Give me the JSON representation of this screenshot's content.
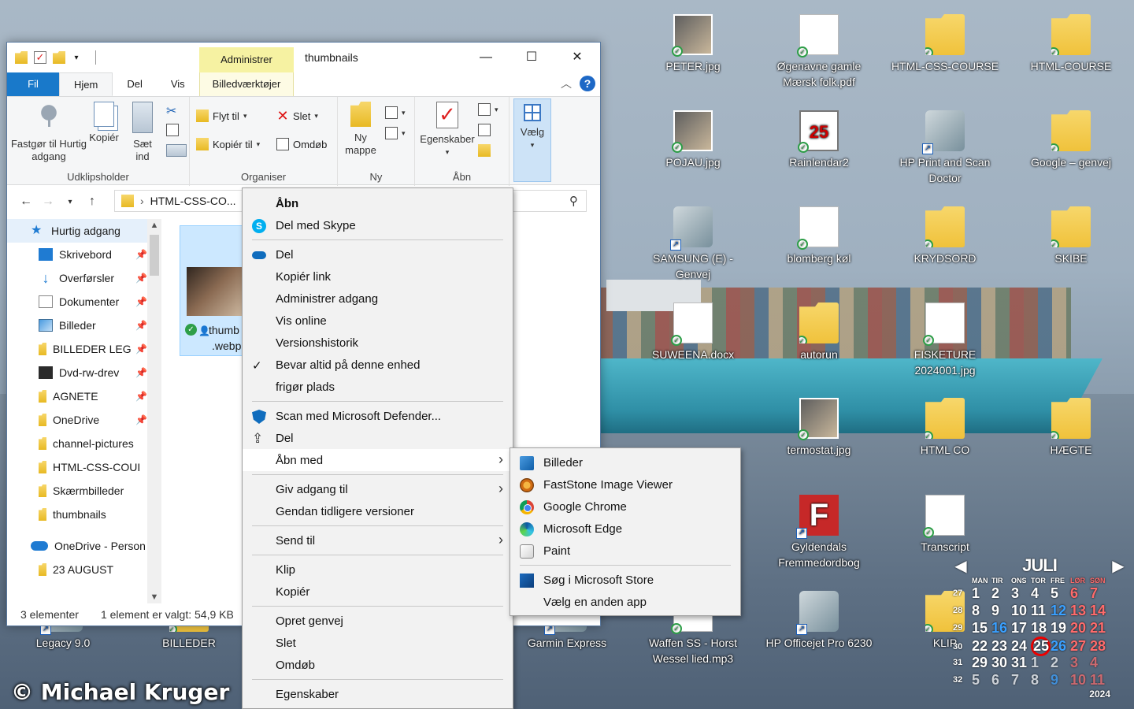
{
  "desktop": {
    "icons": [
      {
        "label": "PETER.jpg",
        "type": "img"
      },
      {
        "label": "Øgenavne gamle Mærsk folk.pdf",
        "type": "doc"
      },
      {
        "label": "HTML-CSS-COURSE",
        "type": "folder"
      },
      {
        "label": "HTML-COURSE",
        "type": "folder"
      },
      {
        "label": "POJAU.jpg",
        "type": "img"
      },
      {
        "label": "Rainlendar2",
        "type": "cal"
      },
      {
        "label": "HP Print and Scan Doctor",
        "type": "tool"
      },
      {
        "label": "Google – genvej",
        "type": "folder"
      },
      {
        "label": "SAMSUNG (E) - Genvej",
        "type": "tool"
      },
      {
        "label": "blomberg køl",
        "type": "doc"
      },
      {
        "label": "KRYDSORD",
        "type": "folder"
      },
      {
        "label": "SKIBE",
        "type": "folder"
      },
      {
        "label": "SUWEENA.docx",
        "type": "doc"
      },
      {
        "label": "autorun",
        "type": "folder"
      },
      {
        "label": "FISKETURE 2024001.jpg",
        "type": "doc"
      },
      {
        "label": "termostat.jpg",
        "type": "img"
      },
      {
        "label": "HTML CO",
        "type": "folder"
      },
      {
        "label": "HÆGTE",
        "type": "folder"
      },
      {
        "label": "Gyldendals Fremmedordbog",
        "type": "app"
      },
      {
        "label": "Transcript",
        "type": "doc"
      },
      {
        "label": "HP Officejet Pro 6230",
        "type": "tool"
      },
      {
        "label": "Waffen SS - Horst Wessel lied.mp3",
        "type": "doc"
      },
      {
        "label": "Garmin Express",
        "type": "tool"
      },
      {
        "label": "Legacy 9.0",
        "type": "tool"
      },
      {
        "label": "BILLEDER",
        "type": "folder"
      },
      {
        "label": "KLIP",
        "type": "folder"
      }
    ],
    "copyright": "© Michael Kruger"
  },
  "calendar": {
    "month": "JULI",
    "weekday_headers": [
      "MAN",
      "TIR",
      "ONS",
      "TOR",
      "FRE",
      "LØR",
      "SØN"
    ],
    "weeks": [
      {
        "wk": "27",
        "days": [
          "1",
          "2",
          "3",
          "4",
          "5",
          "6",
          "7"
        ]
      },
      {
        "wk": "28",
        "days": [
          "8",
          "9",
          "10",
          "11",
          "12",
          "13",
          "14"
        ]
      },
      {
        "wk": "29",
        "days": [
          "15",
          "16",
          "17",
          "18",
          "19",
          "20",
          "21"
        ]
      },
      {
        "wk": "30",
        "days": [
          "22",
          "23",
          "24",
          "25",
          "26",
          "27",
          "28"
        ]
      },
      {
        "wk": "31",
        "days": [
          "29",
          "30",
          "31",
          "1",
          "2",
          "3",
          "4"
        ]
      },
      {
        "wk": "32",
        "days": [
          "5",
          "6",
          "7",
          "8",
          "9",
          "10",
          "11"
        ]
      }
    ],
    "today": "25",
    "year": "2024"
  },
  "explorer": {
    "title": "thumbnails",
    "context_tab_header": "Administrer",
    "tabs": [
      "Fil",
      "Hjem",
      "Del",
      "Vis"
    ],
    "context_tab": "Billedværktøjer",
    "ribbon": {
      "clipboard": {
        "pin": "Fastgør til Hurtig adgang",
        "copy": "Kopiér",
        "paste": "Sæt ind",
        "label": "Udklipsholder"
      },
      "organize": {
        "move_to": "Flyt til",
        "copy_to": "Kopiér til",
        "delete": "Slet",
        "rename": "Omdøb",
        "label": "Organiser"
      },
      "new": {
        "new_folder": "Ny mappe",
        "label": "Ny"
      },
      "open": {
        "properties": "Egenskaber",
        "label": "Åbn"
      },
      "select": {
        "select": "Vælg"
      }
    },
    "address": "HTML-CSS-CO...",
    "nav": [
      {
        "label": "Hurtig adgang",
        "icon": "star-icon",
        "head": true
      },
      {
        "label": "Skrivebord",
        "icon": "desktop-icon",
        "pinned": true
      },
      {
        "label": "Overførsler",
        "icon": "download-icon",
        "pinned": true
      },
      {
        "label": "Dokumenter",
        "icon": "document-icon",
        "pinned": true
      },
      {
        "label": "Billeder",
        "icon": "pictures-icon",
        "pinned": true
      },
      {
        "label": "BILLEDER LEG",
        "icon": "folder-icon",
        "pinned": true
      },
      {
        "label": "Dvd-rw-drev",
        "icon": "dvd-icon",
        "pinned": true
      },
      {
        "label": "AGNETE",
        "icon": "folder-icon",
        "pinned": true
      },
      {
        "label": "OneDrive",
        "icon": "folder-icon",
        "pinned": true
      },
      {
        "label": "channel-pictures",
        "icon": "folder-icon"
      },
      {
        "label": "HTML-CSS-COUI",
        "icon": "folder-icon"
      },
      {
        "label": "Skærmbilleder",
        "icon": "folder-icon"
      },
      {
        "label": "thumbnails",
        "icon": "folder-icon"
      },
      {
        "label": "OneDrive - Person",
        "icon": "cloud-icon",
        "head": false
      },
      {
        "label": "23 AUGUST",
        "icon": "folder-icon"
      }
    ],
    "file": {
      "line1": "thumb",
      "line2": ".webp"
    },
    "status": {
      "count": "3 elementer",
      "selected": "1 element er valgt: 54,9 KB"
    }
  },
  "context_menu": {
    "items": [
      {
        "label": "Åbn",
        "bold": true
      },
      {
        "label": "Del med Skype",
        "icon": "skype-icon"
      },
      {
        "sep": true
      },
      {
        "label": "Del",
        "icon": "onedrive-icon"
      },
      {
        "label": "Kopiér link"
      },
      {
        "label": "Administrer adgang"
      },
      {
        "label": "Vis online"
      },
      {
        "label": "Versionshistorik"
      },
      {
        "label": "Bevar altid på denne enhed",
        "icon": "check-icon"
      },
      {
        "label": "frigør plads"
      },
      {
        "sep": true
      },
      {
        "label": "Scan med Microsoft Defender...",
        "icon": "defender-icon"
      },
      {
        "label": "Del",
        "icon": "share-icon"
      },
      {
        "label": "Åbn med",
        "submenu": true,
        "hover": true
      },
      {
        "sep": true
      },
      {
        "label": "Giv adgang til",
        "submenu": true
      },
      {
        "label": "Gendan tidligere versioner"
      },
      {
        "sep": true
      },
      {
        "label": "Send til",
        "submenu": true
      },
      {
        "sep": true
      },
      {
        "label": "Klip"
      },
      {
        "label": "Kopiér"
      },
      {
        "sep": true
      },
      {
        "label": "Opret genvej"
      },
      {
        "label": "Slet"
      },
      {
        "label": "Omdøb"
      },
      {
        "sep": true
      },
      {
        "label": "Egenskaber"
      }
    ]
  },
  "open_with_menu": {
    "items": [
      {
        "label": "Billeder",
        "icon": "photos-icon"
      },
      {
        "label": "FastStone Image Viewer",
        "icon": "faststone-icon"
      },
      {
        "label": "Google Chrome",
        "icon": "chrome-icon"
      },
      {
        "label": "Microsoft Edge",
        "icon": "edge-icon"
      },
      {
        "label": "Paint",
        "icon": "paint-icon"
      },
      {
        "sep": true
      },
      {
        "label": "Søg i Microsoft Store",
        "icon": "store-icon"
      },
      {
        "label": "Vælg en anden app"
      }
    ]
  }
}
